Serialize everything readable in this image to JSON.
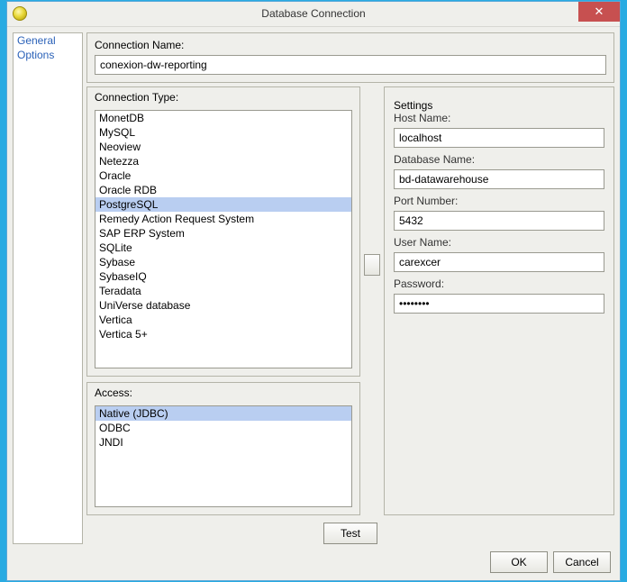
{
  "window": {
    "title": "Database Connection"
  },
  "sidebar": {
    "items": [
      {
        "label": "General"
      },
      {
        "label": "Options"
      }
    ]
  },
  "connection_name": {
    "label": "Connection Name:",
    "value": "conexion-dw-reporting"
  },
  "connection_type": {
    "label": "Connection Type:",
    "selected": "PostgreSQL",
    "options": [
      "MonetDB",
      "MySQL",
      "Neoview",
      "Netezza",
      "Oracle",
      "Oracle RDB",
      "PostgreSQL",
      "Remedy Action Request System",
      "SAP ERP System",
      "SQLite",
      "Sybase",
      "SybaseIQ",
      "Teradata",
      "UniVerse database",
      "Vertica",
      "Vertica 5+"
    ]
  },
  "access": {
    "label": "Access:",
    "selected": "Native (JDBC)",
    "options": [
      "Native (JDBC)",
      "ODBC",
      "JNDI"
    ]
  },
  "settings": {
    "legend": "Settings",
    "host_label": "Host Name:",
    "host_value": "localhost",
    "db_label": "Database Name:",
    "db_value": "bd-datawarehouse",
    "port_label": "Port Number:",
    "port_value": "5432",
    "user_label": "User Name:",
    "user_value": "carexcer",
    "password_label": "Password:",
    "password_value": "••••••••"
  },
  "buttons": {
    "test": "Test",
    "ok": "OK",
    "cancel": "Cancel"
  }
}
